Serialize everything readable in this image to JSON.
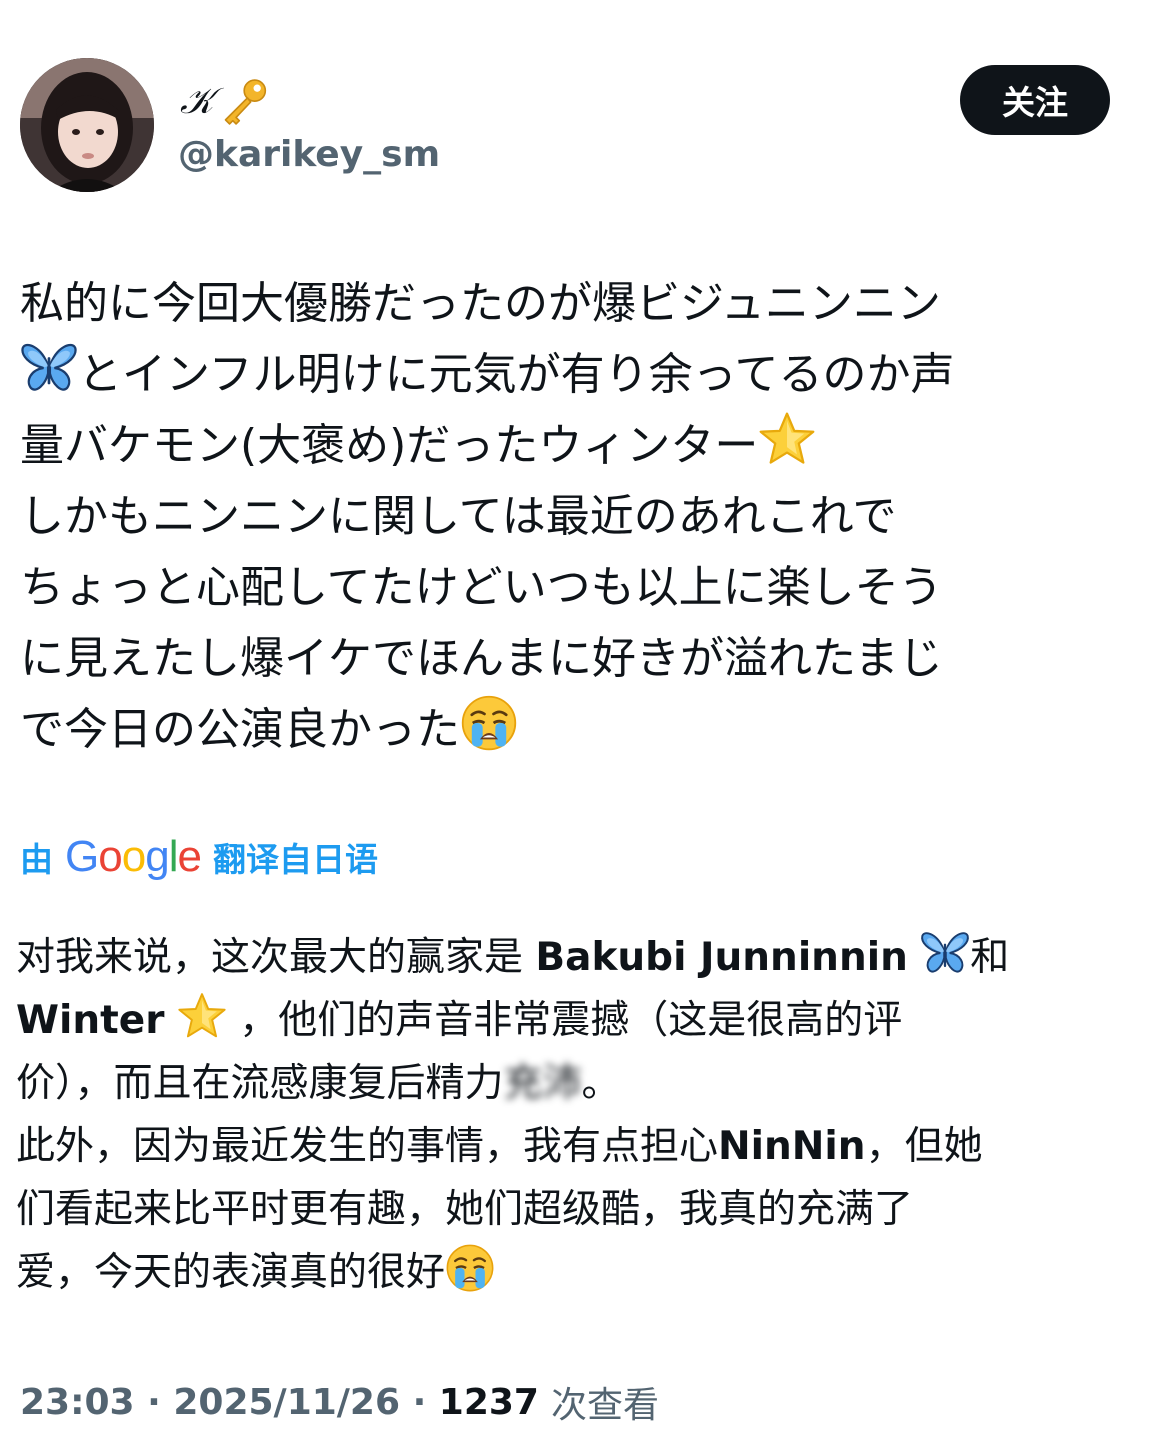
{
  "user": {
    "display_name": "𝒦",
    "handle": "@karikey_sm",
    "follow_label": "关注"
  },
  "tweet": {
    "jp_lines": [
      "私的に今回大優勝だったのが爆ビジュニンニン",
      "とインフル明けに元気が有り余ってるのか声",
      "量バケモン(大褒め)だったウィンター",
      "しかもニンニンに関しては最近のあれこれで",
      "ちょっと心配してたけどいつも以上に楽しそう",
      "に見えたし爆イケでほんまに好きが溢れたまじ",
      "で今日の公演良かった"
    ]
  },
  "translation": {
    "prefix": "由",
    "google_label": "Google",
    "suffix": "翻译自日语",
    "line1_a": "对我来说，这次最大的赢家是 ",
    "line1_b": "Bakubi Junninnin",
    "line1_c": "和",
    "line2_a": "Winter",
    "line2_b": "，他们的声音非常震撼（这是很高的评",
    "line3_a": "价），而且在流感康复后精力",
    "line3_blur": "充沛",
    "line3_b": "。",
    "line4_a": "此外，因为最近发生的事情，我有点担心",
    "line4_b": "NinNin",
    "line4_c": "，但她",
    "line5": "们看起来比平时更有趣，她们超级酷，我真的充满了",
    "line6": "爱，今天的表演真的很好"
  },
  "meta": {
    "time": "23:03",
    "sep": " · ",
    "date": "2025/11/26",
    "views_count": "1237",
    "views_label": "次查看"
  },
  "icons": {
    "key": "key-icon",
    "butterfly": "butterfly-emoji",
    "star": "star-emoji",
    "crying": "crying-face-emoji"
  },
  "colors": {
    "link_blue": "#1d9bf0",
    "secondary": "#536471",
    "text": "#0f1419"
  }
}
